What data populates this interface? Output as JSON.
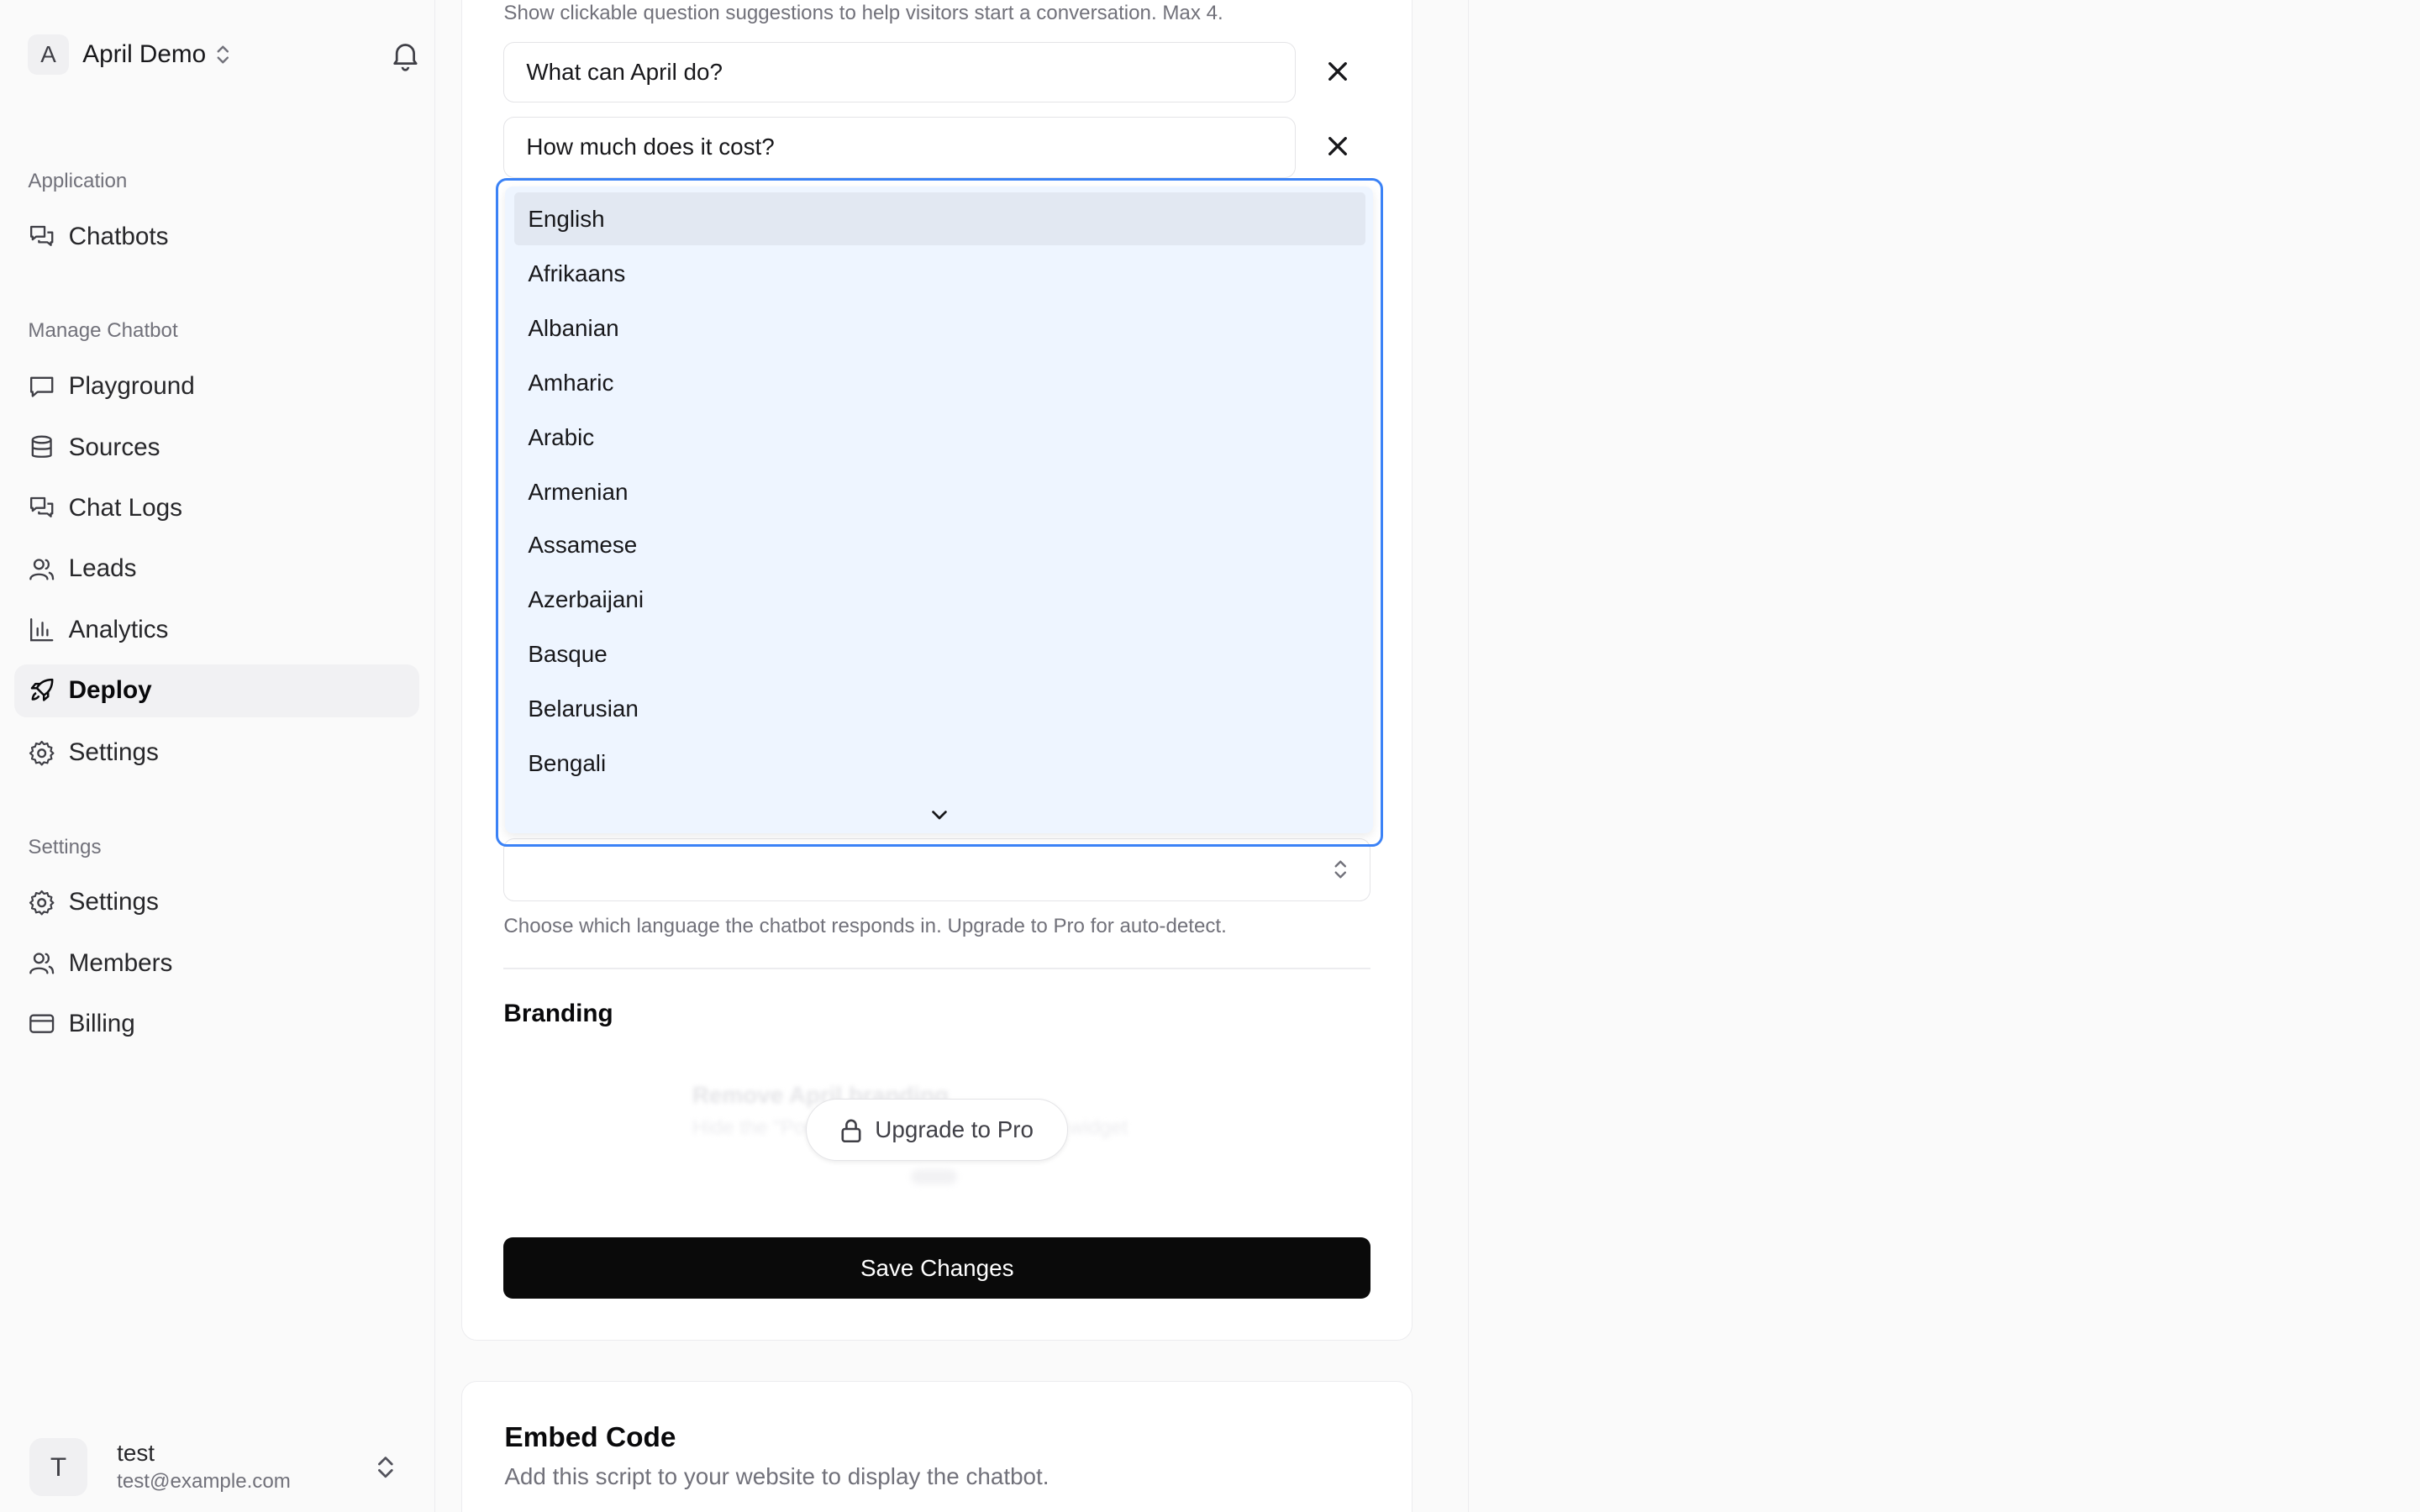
{
  "workspace": {
    "initial": "A",
    "name": "April Demo"
  },
  "sidebar": {
    "groups": [
      {
        "label": "Application",
        "items": [
          {
            "label": "Chatbots",
            "icon": "chat-bubbles-icon"
          }
        ]
      },
      {
        "label": "Manage Chatbot",
        "items": [
          {
            "label": "Playground",
            "icon": "message-square-icon"
          },
          {
            "label": "Sources",
            "icon": "database-icon"
          },
          {
            "label": "Chat Logs",
            "icon": "chat-bubbles-icon"
          },
          {
            "label": "Leads",
            "icon": "users-icon"
          },
          {
            "label": "Analytics",
            "icon": "bar-chart-icon"
          },
          {
            "label": "Deploy",
            "icon": "rocket-icon",
            "active": true
          },
          {
            "label": "Settings",
            "icon": "gear-icon"
          }
        ]
      },
      {
        "label": "Settings",
        "items": [
          {
            "label": "Settings",
            "icon": "gear-icon"
          },
          {
            "label": "Members",
            "icon": "users-icon"
          },
          {
            "label": "Billing",
            "icon": "credit-card-icon"
          }
        ]
      }
    ]
  },
  "user": {
    "initial": "T",
    "name": "test",
    "email": "test@example.com"
  },
  "suggestions": {
    "hint": "Show clickable question suggestions to help visitors start a conversation. Max 4.",
    "items": [
      "What can April do?",
      "How much does it cost?"
    ]
  },
  "language": {
    "hint": "Choose which language the chatbot responds in. Upgrade to Pro for auto-detect.",
    "options": [
      "English",
      "Afrikaans",
      "Albanian",
      "Amharic",
      "Arabic",
      "Armenian",
      "Assamese",
      "Azerbaijani",
      "Basque",
      "Belarusian",
      "Bengali"
    ],
    "highlighted": "English"
  },
  "branding": {
    "title": "Branding",
    "blurred_title": "Remove April branding",
    "blurred_desc": "Hide the \"Powered by April\" badge on the widget",
    "upgrade_label": "Upgrade to Pro"
  },
  "save_label": "Save Changes",
  "embed": {
    "title": "Embed Code",
    "description": "Add this script to your website to display the chatbot."
  }
}
